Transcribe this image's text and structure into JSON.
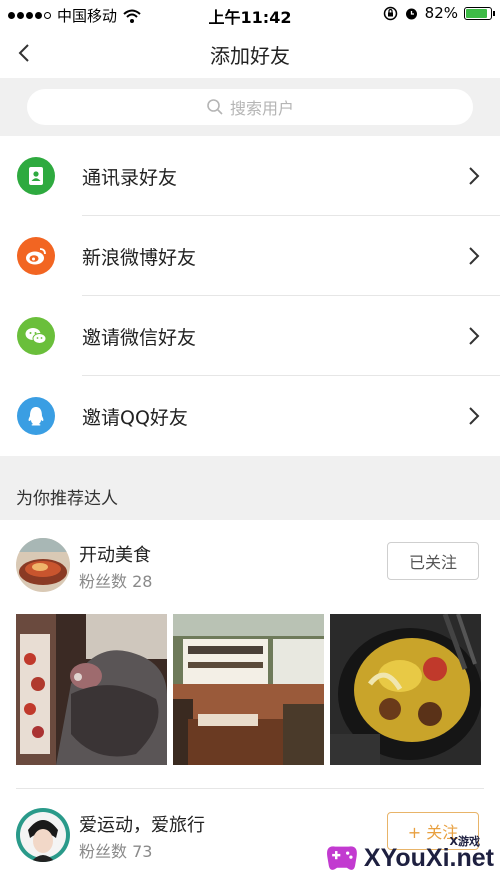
{
  "status_bar": {
    "carrier": "中国移动",
    "time": "上午11:42",
    "battery": "82%"
  },
  "nav": {
    "title": "添加好友"
  },
  "search": {
    "placeholder": "搜索用户"
  },
  "friend_sources": [
    {
      "label": "通讯录好友",
      "icon": "contacts-icon",
      "color": "#2eaa3f"
    },
    {
      "label": "新浪微博好友",
      "icon": "weibo-icon",
      "color": "#f26522"
    },
    {
      "label": "邀请微信好友",
      "icon": "wechat-icon",
      "color": "#6abf3b"
    },
    {
      "label": "邀请QQ好友",
      "icon": "qq-icon",
      "color": "#3a9ee3"
    }
  ],
  "recommend": {
    "title": "为你推荐达人",
    "users": [
      {
        "name": "开动美食",
        "fans": "粉丝数 28",
        "button": "已关注"
      },
      {
        "name": "爱运动，爱旅行",
        "fans": "粉丝数 73",
        "button": "+ 关注"
      }
    ]
  },
  "watermark": {
    "brand": "XYouXi.net",
    "small": "X游戏"
  }
}
